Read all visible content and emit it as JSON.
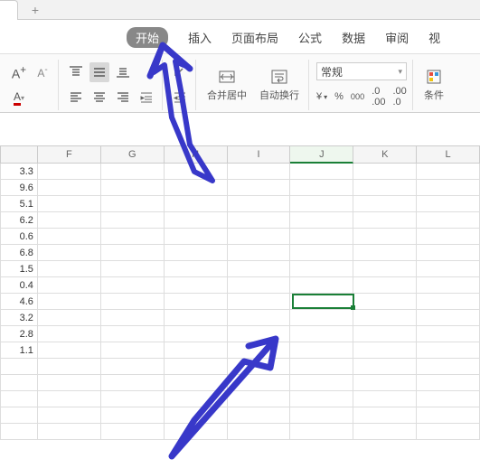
{
  "tabstrip": {
    "new_tab": "+"
  },
  "ribbon_tabs": {
    "home": "开始",
    "insert": "插入",
    "layout": "页面布局",
    "formulas": "公式",
    "data": "数据",
    "review": "审阅",
    "view": "视"
  },
  "ribbon": {
    "font_inc": "A⁺",
    "font_dec": "A⁻",
    "merge_center": "合并居中",
    "wrap_text": "自动换行",
    "num_format": "常规",
    "decimal_inc": ".00",
    "decimal_dec": ".0",
    "cond_format": "条件"
  },
  "columns": [
    "",
    "F",
    "G",
    "H",
    "I",
    "J",
    "K",
    "L"
  ],
  "selected_col": "J",
  "cells_colE": [
    "3.3",
    "9.6",
    "5.1",
    "6.2",
    "0.6",
    "6.8",
    "1.5",
    "0.4",
    "4.6",
    "3.2",
    "2.8",
    "1.1",
    "",
    "",
    "",
    "",
    ""
  ],
  "chart_data": {
    "type": "table",
    "title": "",
    "columns": [
      "F",
      "G",
      "H",
      "I",
      "J",
      "K",
      "L"
    ],
    "partial_left_column_values": [
      3.3,
      9.6,
      5.1,
      6.2,
      0.6,
      6.8,
      1.5,
      0.4,
      4.6,
      3.2,
      2.8,
      1.1
    ],
    "selected_cell": "J (row 8 visible)"
  }
}
